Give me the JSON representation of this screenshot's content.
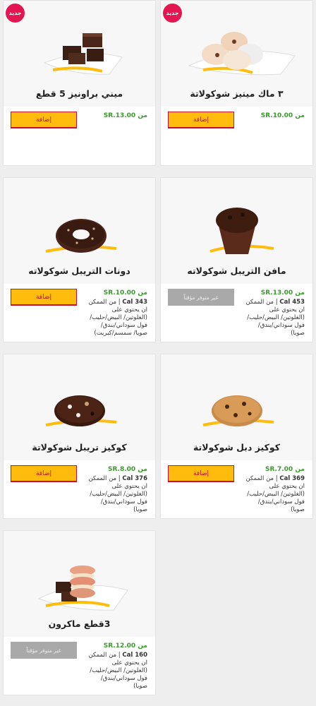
{
  "currency": "SR.",
  "price_prefix": "من",
  "new_badge": "جديد",
  "colors": {
    "accent_yellow": "#ffbc0d",
    "accent_red": "#c8102e",
    "price_green": "#3a9b2c",
    "badge_pink": "#e31652",
    "disabled_gray": "#a9a9a9"
  },
  "products": [
    {
      "name": "٣ ماك مينيز شوكولاتة",
      "price": "10.00",
      "is_new": true,
      "button": "إضافة",
      "available": true,
      "calories": "",
      "allergens": ""
    },
    {
      "name": "ميني براونيز 5 قطع",
      "price": "13.00",
      "is_new": true,
      "button": "إضافة",
      "available": true,
      "calories": "",
      "allergens": ""
    },
    {
      "name": "مافن التريبل شوكولاته",
      "price": "13.00",
      "is_new": false,
      "button": "غير متوفر مؤقتاً",
      "available": false,
      "calories": "453 Cal",
      "allergens": "من الممكن ان يحتوي على (الغلوتين/ البيض/حليب/فول سوداني/بندق/صويا)"
    },
    {
      "name": "دونات التريبل شوكولاته",
      "price": "10.00",
      "is_new": false,
      "button": "إضافة",
      "available": true,
      "calories": "343 Cal",
      "allergens": "من الممكن ان يحتوي على (الغلوتين/ البيض/حليب/فول سوداني/بندق/صويا/ سمسم/كبريت)"
    },
    {
      "name": "كوكيز دبل شوكولاتة",
      "price": "7.00",
      "is_new": false,
      "button": "إضافة",
      "available": true,
      "calories": "369 Cal",
      "allergens": "من الممكن ان يحتوي على (الغلوتين/ البيض/حليب/فول سوداني/بندق/صويا)"
    },
    {
      "name": "كوكيز تريبل شوكولاتة",
      "price": "8.00",
      "is_new": false,
      "button": "إضافة",
      "available": true,
      "calories": "376 Cal",
      "allergens": "من الممكن ان يحتوي على (الغلوتين/ البيض/حليب/فول سوداني/بندق/صويا)"
    },
    {
      "name": "3قطع ماكرون",
      "price": "12.00",
      "is_new": false,
      "button": "غير متوفر مؤقتاً",
      "available": false,
      "calories": "160 Cal",
      "allergens": "من الممكن ان يحتوي على (الغلوتين/ البيض/حليب/فول سوداني/بندق/صويا)"
    }
  ]
}
